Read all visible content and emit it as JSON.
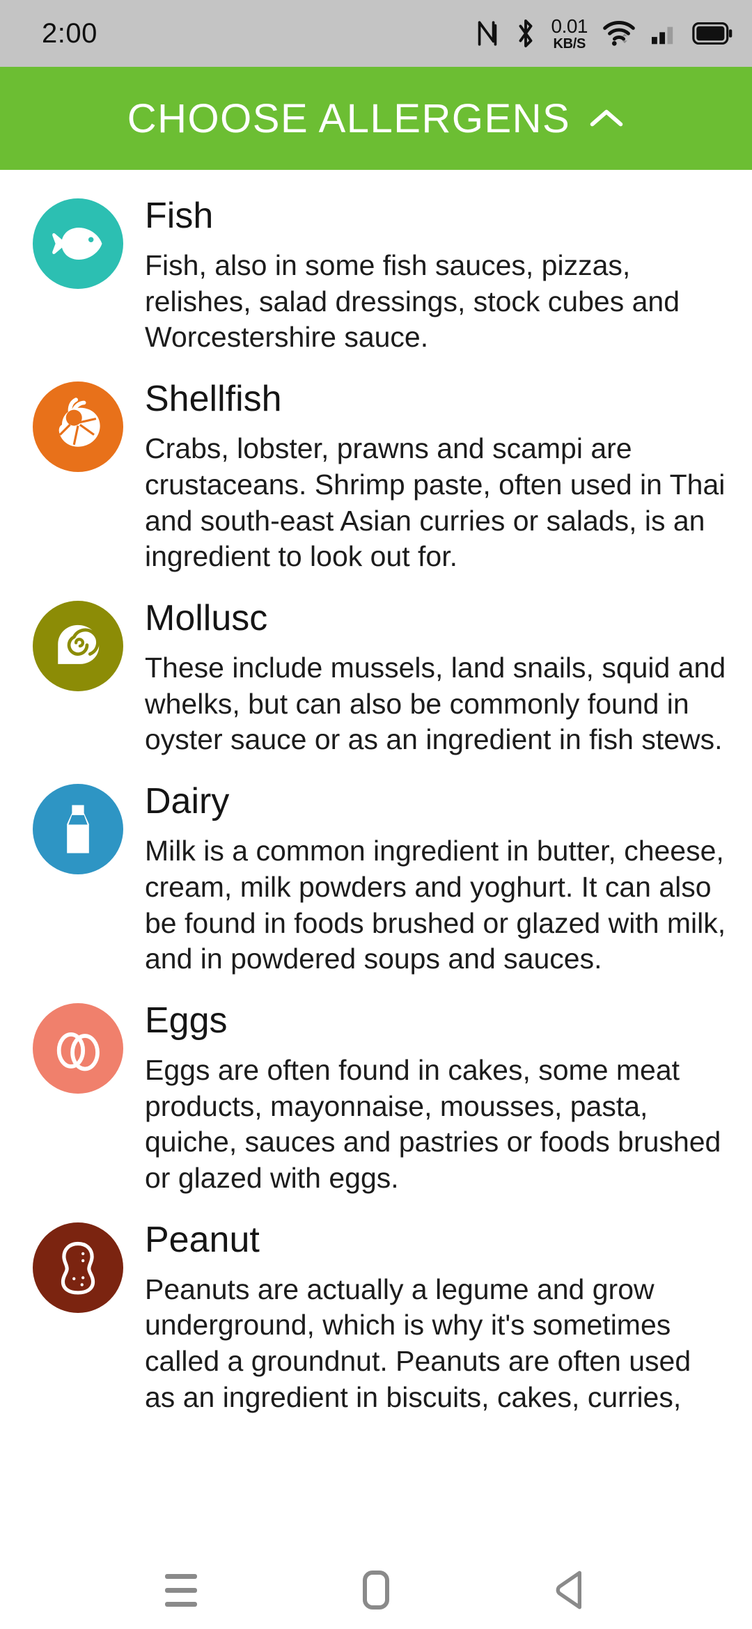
{
  "status_bar": {
    "clock": "2:00",
    "nfc_icon": "nfc-icon",
    "bluetooth_icon": "bluetooth-icon",
    "net_speed_value": "0.01",
    "net_speed_unit": "KB/S",
    "wifi_icon": "wifi-icon",
    "signal_icon": "cellular-signal-icon",
    "battery_icon": "battery-icon",
    "background": "#c4c4c4"
  },
  "header": {
    "title": "CHOOSE ALLERGENS",
    "chevron_icon": "chevron-up-icon",
    "background": "#6cbe33",
    "text_color": "#ffffff"
  },
  "allergens": [
    {
      "name": "Fish",
      "icon": "fish-icon",
      "color": "#2cbfb2",
      "description": "Fish, also in some fish sauces, pizzas, relishes, salad dressings, stock cubes and Worcestershire sauce."
    },
    {
      "name": "Shellfish",
      "icon": "shrimp-icon",
      "color": "#e8711a",
      "description": "Crabs, lobster, prawns and scampi are crustaceans. Shrimp paste, often used in Thai and south-east Asian curries or salads, is an ingredient to look out for."
    },
    {
      "name": "Mollusc",
      "icon": "snail-shell-icon",
      "color": "#8c8c06",
      "description": "These include mussels, land snails, squid and whelks, but can also be commonly found in oyster sauce or as an ingredient in fish stews."
    },
    {
      "name": "Dairy",
      "icon": "milk-bottle-icon",
      "color": "#2e95c4",
      "description": "Milk is a common ingredient in butter, cheese, cream, milk powders and yoghurt. It can also be found in foods brushed or glazed with milk, and in powdered soups and sauces."
    },
    {
      "name": "Eggs",
      "icon": "eggs-icon",
      "color": "#f0806c",
      "description": "Eggs are often found in cakes, some meat products, mayonnaise, mousses, pasta, quiche, sauces and pastries or foods brushed or glazed with eggs."
    },
    {
      "name": "Peanut",
      "icon": "peanut-icon",
      "color": "#7b2410",
      "description": "Peanuts are actually a legume and grow underground, which is why it's sometimes called a groundnut. Peanuts are often used as an ingredient in biscuits, cakes, curries,"
    }
  ],
  "nav_bar": {
    "recents_icon": "recent-apps-icon",
    "home_icon": "home-icon",
    "back_icon": "back-icon",
    "icon_color": "#8a8a8a"
  }
}
